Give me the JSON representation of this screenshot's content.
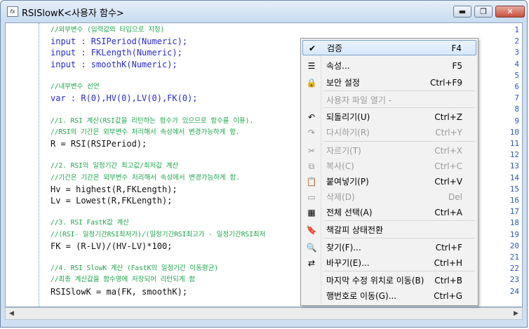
{
  "window": {
    "title": "RSISlowK<사용자 함수>",
    "minimize": "▬",
    "restore": "❐",
    "close": "✕"
  },
  "code_lines": [
    {
      "n": "1",
      "cls": "cm",
      "text": "//외부변수 (입력값의 타입으로 지정)"
    },
    {
      "n": "2",
      "cls": "kw",
      "text": "input : RSIPeriod(Numeric);"
    },
    {
      "n": "3",
      "cls": "kw",
      "text": "input : FKLength(Numeric);"
    },
    {
      "n": "4",
      "cls": "kw",
      "text": "input : smoothK(Numeric);"
    },
    {
      "n": "5",
      "cls": "tx",
      "text": ""
    },
    {
      "n": "6",
      "cls": "cm",
      "text": "//내부변수 선언"
    },
    {
      "n": "7",
      "cls": "kw",
      "text": "var : R(0),HV(0),LV(0),FK(0);"
    },
    {
      "n": "8",
      "cls": "tx",
      "text": ""
    },
    {
      "n": "9",
      "cls": "cm",
      "text": "//1. RSI 계산(RSI값을 리턴하는 함수가 있으므로 함수를 이용)."
    },
    {
      "n": "10",
      "cls": "cm",
      "text": "//RSI의 기간은 외부변수 처리해서 속성에서 변경가능하게 함."
    },
    {
      "n": "11",
      "cls": "tx",
      "text": "R = RSI(RSIPeriod);"
    },
    {
      "n": "12",
      "cls": "tx",
      "text": ""
    },
    {
      "n": "13",
      "cls": "cm",
      "text": "//2. RSI의 일정기간 최고값/최저값 계산"
    },
    {
      "n": "14",
      "cls": "cm",
      "text": "//기간은 기간은 외부변수 처리해서 속성에서 변경가능하게 함."
    },
    {
      "n": "15",
      "cls": "tx",
      "text": "Hv = highest(R,FKLength);"
    },
    {
      "n": "16",
      "cls": "tx",
      "text": "Lv = Lowest(R,FKLength);"
    },
    {
      "n": "17",
      "cls": "tx",
      "text": ""
    },
    {
      "n": "18",
      "cls": "cm",
      "text": "//3. RSI FastK값 계산"
    },
    {
      "n": "19",
      "cls": "cm",
      "text": "//(RSI- 일정기간RSI최저가)/(일정기간RSI최고가 - 일정기간RSI최저"
    },
    {
      "n": "20",
      "cls": "tx",
      "text": "FK = (R-LV)/(HV-LV)*100;"
    },
    {
      "n": "21",
      "cls": "tx",
      "text": ""
    },
    {
      "n": "22",
      "cls": "cm",
      "text": "//4. RSI SlowK 계산 (FastK의 일정기간 이동평균)"
    },
    {
      "n": "23",
      "cls": "cm",
      "text": "//최종 계산값을 함수명에 저장되어 리턴되게 함"
    },
    {
      "n": "24",
      "cls": "tx",
      "text": "RSISlowK = ma(FK, smoothK);"
    }
  ],
  "scrollbar": {
    "left_arrow": "◀",
    "right_arrow": "▶"
  },
  "context_menu": [
    {
      "name": "menu-verify",
      "icon": "verify-icon",
      "glyph": "✔",
      "label": "검증",
      "shortcut": "F4",
      "state": "selected"
    },
    {
      "name": "menu-properties",
      "icon": "properties-icon",
      "glyph": "☰",
      "label": "속성...",
      "shortcut": "F5",
      "state": "normal"
    },
    {
      "name": "menu-security",
      "icon": "lock-icon",
      "glyph": "🔒",
      "label": "보안 설정",
      "shortcut": "Ctrl+F9",
      "state": "normal"
    },
    {
      "name": "menu-open-user-file",
      "icon": "",
      "glyph": "",
      "label": "사용자 파일 열기 -",
      "shortcut": "",
      "state": "disabled"
    },
    {
      "name": "menu-undo",
      "icon": "undo-icon",
      "glyph": "↶",
      "label": "되돌리기(U)",
      "shortcut": "Ctrl+Z",
      "state": "normal"
    },
    {
      "name": "menu-redo",
      "icon": "redo-icon",
      "glyph": "↷",
      "label": "다시하기(R)",
      "shortcut": "Ctrl+Y",
      "state": "disabled"
    },
    {
      "name": "menu-cut",
      "icon": "cut-icon",
      "glyph": "✂",
      "label": "자르기(T)",
      "shortcut": "Ctrl+X",
      "state": "disabled"
    },
    {
      "name": "menu-copy",
      "icon": "copy-icon",
      "glyph": "⧉",
      "label": "복사(C)",
      "shortcut": "Ctrl+C",
      "state": "disabled"
    },
    {
      "name": "menu-paste",
      "icon": "paste-icon",
      "glyph": "📋",
      "label": "붙여넣기(P)",
      "shortcut": "Ctrl+V",
      "state": "normal"
    },
    {
      "name": "menu-delete",
      "icon": "delete-icon",
      "glyph": "▭",
      "label": "삭제(D)",
      "shortcut": "Del",
      "state": "disabled"
    },
    {
      "name": "menu-select-all",
      "icon": "select-all-icon",
      "glyph": "▦",
      "label": "전체 선택(A)",
      "shortcut": "Ctrl+A",
      "state": "normal"
    },
    {
      "name": "menu-bookmark-toggle",
      "icon": "bookmark-icon",
      "glyph": "🔖",
      "label": "책갈피 상태전환",
      "shortcut": "",
      "state": "normal"
    },
    {
      "name": "menu-find",
      "icon": "find-icon",
      "glyph": "🔍",
      "label": "찾기(F)...",
      "shortcut": "Ctrl+F",
      "state": "normal"
    },
    {
      "name": "menu-replace",
      "icon": "replace-icon",
      "glyph": "⇄",
      "label": "바꾸기(E)...",
      "shortcut": "Ctrl+H",
      "state": "normal"
    },
    {
      "name": "menu-goto-last-edit",
      "icon": "",
      "glyph": "",
      "label": "마지막 수정 위치로 이동(B)",
      "shortcut": "Ctrl+B",
      "state": "normal"
    },
    {
      "name": "menu-goto-line",
      "icon": "",
      "glyph": "",
      "label": "행번호로 이동(G)...",
      "shortcut": "Ctrl+G",
      "state": "normal"
    }
  ]
}
